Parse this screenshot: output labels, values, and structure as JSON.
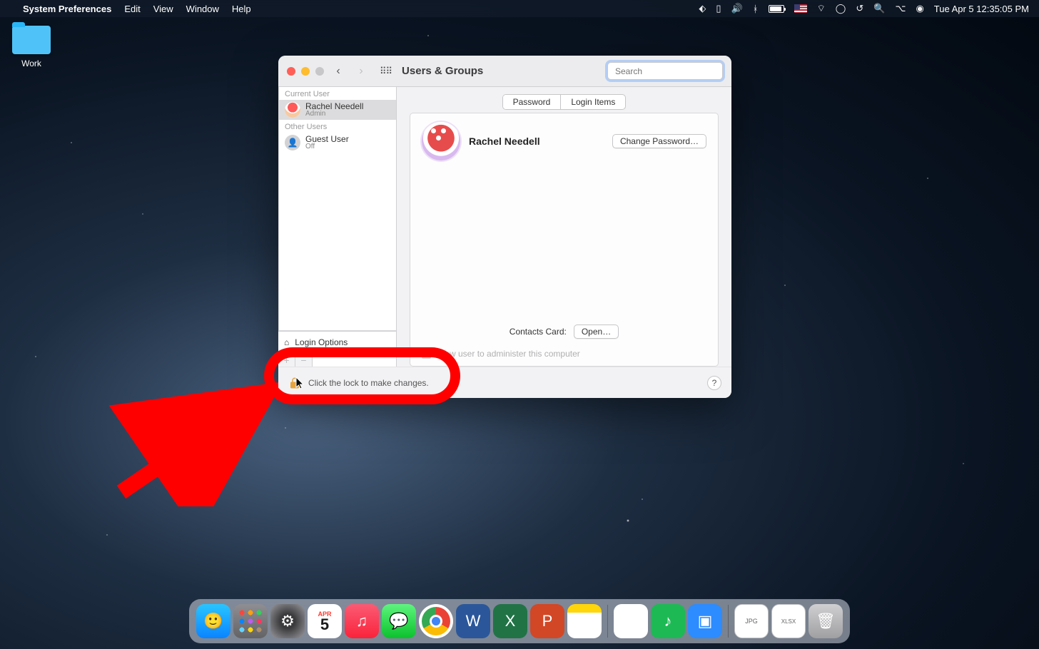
{
  "menubar": {
    "app": "System Preferences",
    "menus": [
      "Edit",
      "View",
      "Window",
      "Help"
    ],
    "datetime": "Tue Apr 5  12:35:05 PM"
  },
  "desktop": {
    "folder_label": "Work"
  },
  "window": {
    "title": "Users & Groups",
    "search_placeholder": "Search",
    "sidebar": {
      "current_header": "Current User",
      "current_user": {
        "name": "Rachel Needell",
        "role": "Admin"
      },
      "other_header": "Other Users",
      "other_users": [
        {
          "name": "Guest User",
          "role": "Off"
        }
      ],
      "login_options": "Login Options"
    },
    "tabs": {
      "password": "Password",
      "login_items": "Login Items"
    },
    "profile": {
      "name": "Rachel Needell",
      "change_pw": "Change Password…"
    },
    "contacts": {
      "label": "Contacts Card:",
      "button": "Open…"
    },
    "allow_admin": "Allow user to administer this computer",
    "lock_text": "Click the lock to make changes.",
    "help": "?"
  },
  "dock": {
    "cal_month": "APR",
    "cal_day": "5",
    "word": "W",
    "excel": "X",
    "ppt": "P",
    "music": "♫",
    "msg": "💬",
    "spotify": "♪",
    "zoom": "▣",
    "slack": "❉",
    "file1": "JPG",
    "file2": "XLSX"
  }
}
